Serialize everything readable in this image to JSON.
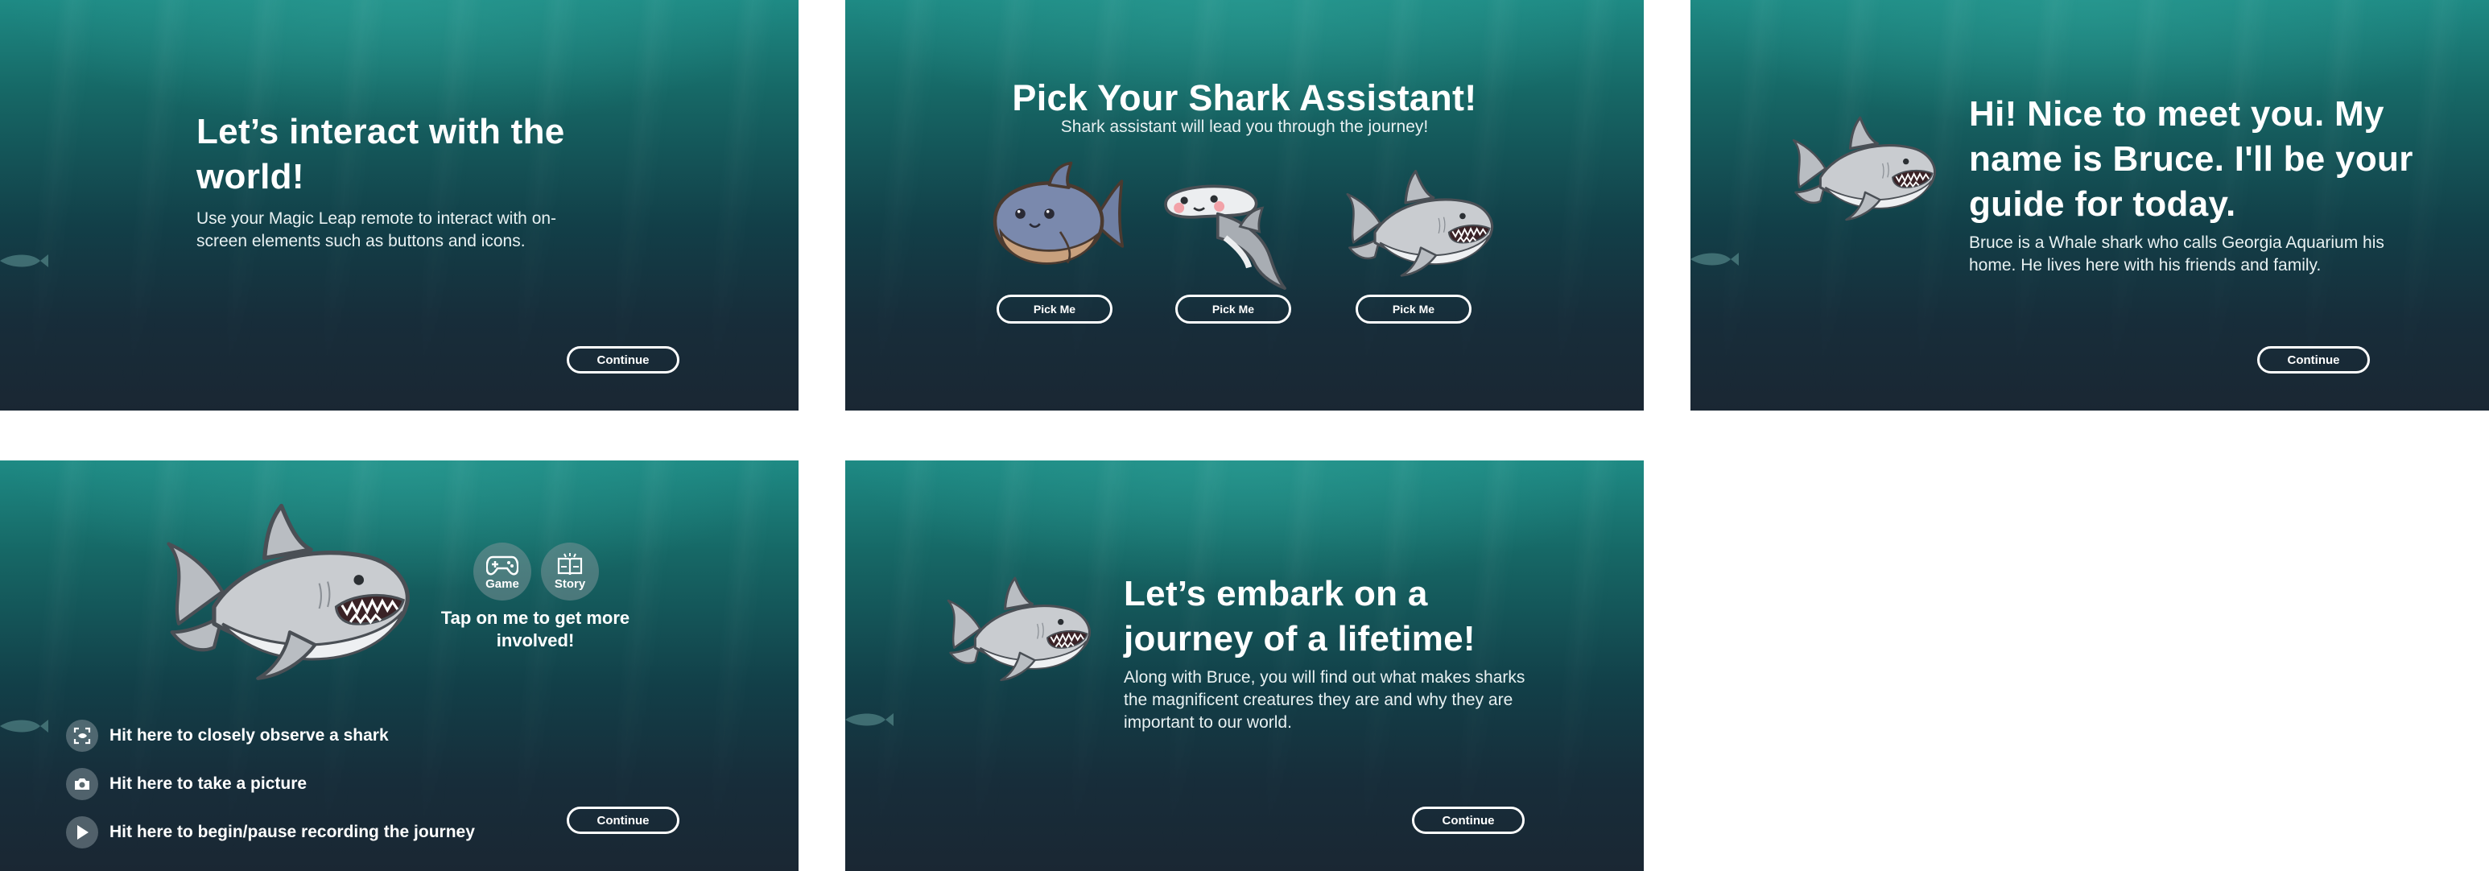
{
  "panel1": {
    "title": "Let’s interact with the world!",
    "body": "Use your Magic Leap remote to interact with on-screen elements such as buttons and icons.",
    "continue_label": "Continue"
  },
  "panel2": {
    "title": "Pick Your Shark Assistant!",
    "subtitle": "Shark assistant will lead you through the journey!",
    "pick_labels": [
      "Pick Me",
      "Pick Me",
      "Pick Me"
    ]
  },
  "panel3": {
    "title": "Hi! Nice to meet you. My name is Bruce.  I'll be your guide for today.",
    "body": "Bruce is a Whale shark who calls Georgia Aquarium his home. He lives here with his friends and family.",
    "continue_label": "Continue"
  },
  "panel4": {
    "game_label": "Game",
    "story_label": "Story",
    "tap_text": "Tap on me to get more involved!",
    "actions": [
      {
        "icon": "observe-icon",
        "label": "Hit here to closely observe a shark"
      },
      {
        "icon": "camera-icon",
        "label": "Hit here to take a picture"
      },
      {
        "icon": "play-icon",
        "label": "Hit here to begin/pause recording the journey"
      }
    ],
    "continue_label": "Continue"
  },
  "panel5": {
    "title": "Let’s embark on a journey of a lifetime!",
    "body": "Along with Bruce, you will find out what makes sharks the magnificent creatures they are and why they are important to our world.",
    "continue_label": "Continue"
  },
  "colors": {
    "water_top": "#1e8a84",
    "water_bottom": "#1a2733",
    "text": "#ffffff",
    "shark_grey": "#c9ccd0",
    "cute_shark_blue": "#6f7fa3"
  }
}
